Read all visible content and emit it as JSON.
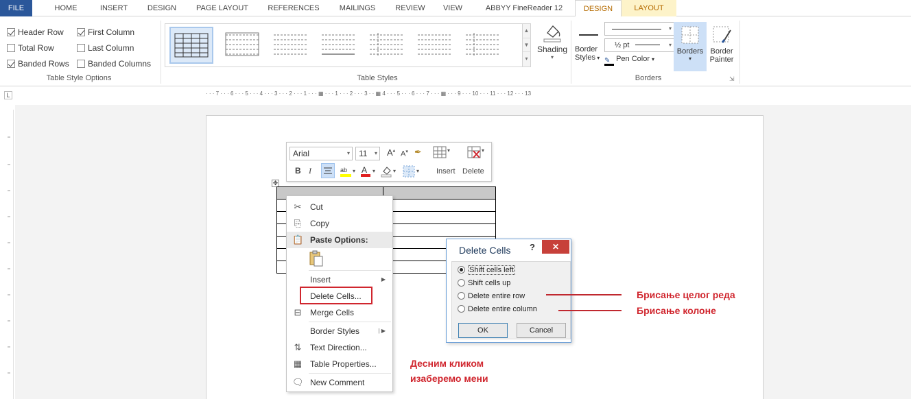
{
  "tabs": {
    "file": "FILE",
    "home": "HOME",
    "insert": "INSERT",
    "design": "DESIGN",
    "page_layout": "PAGE LAYOUT",
    "references": "REFERENCES",
    "mailings": "MAILINGS",
    "review": "REVIEW",
    "view": "VIEW",
    "abbyy": "ABBYY FineReader 12",
    "ctx_design": "DESIGN",
    "ctx_layout": "LAYOUT"
  },
  "style_options": {
    "header_row": "Header Row",
    "first_column": "First Column",
    "total_row": "Total Row",
    "last_column": "Last Column",
    "banded_rows": "Banded Rows",
    "banded_columns": "Banded Columns",
    "group_label": "Table Style Options"
  },
  "table_styles": {
    "group_label": "Table Styles",
    "shading": "Shading"
  },
  "borders": {
    "border_styles_line1": "Border",
    "border_styles_line2": "Styles",
    "pen_weight": "½ pt",
    "pen_color": "Pen Color",
    "borders_btn": "Borders",
    "border_painter_line1": "Border",
    "border_painter_line2": "Painter",
    "group_label": "Borders"
  },
  "ruler": {
    "corner": "L",
    "text": "· · · 7 · · · 6 · · · 5 · · · 4 · · · 3 · · · 2 · · · 1 · · · ▦ · · · 1 · · · 2 · · · 3 · · ▦ 4 · · · 5 · · · 6 · · · 7 · · · ▦ · · · 9 · · · 10 · · · 11 · · · 12 · · · 13"
  },
  "minibar": {
    "font": "Arial",
    "size": "11",
    "bold": "B",
    "italic": "I",
    "insert": "Insert",
    "delete": "Delete"
  },
  "context_menu": {
    "cut": "Cut",
    "copy": "Copy",
    "paste_options": "Paste Options:",
    "insert": "Insert",
    "delete_cells": "Delete Cells...",
    "merge_cells": "Merge Cells",
    "border_styles": "Border Styles",
    "text_direction": "Text Direction...",
    "table_properties": "Table Properties...",
    "new_comment": "New Comment"
  },
  "dialog": {
    "title": "Delete Cells",
    "help": "?",
    "close": "✕",
    "shift_left": "Shift cells left",
    "shift_up": "Shift cells up",
    "delete_row": "Delete entire row",
    "delete_column": "Delete entire column",
    "ok": "OK",
    "cancel": "Cancel"
  },
  "annotations": {
    "row": "Брисање целог реда",
    "column": "Брисање колоне",
    "right_click_line1": "Десним кликом",
    "right_click_line2": "изаберемо мени"
  },
  "colors": {
    "file_tab": "#2b579a",
    "context_tab": "#fdf3c9",
    "annotation_red": "#d0262e",
    "close_red": "#c7403a"
  }
}
